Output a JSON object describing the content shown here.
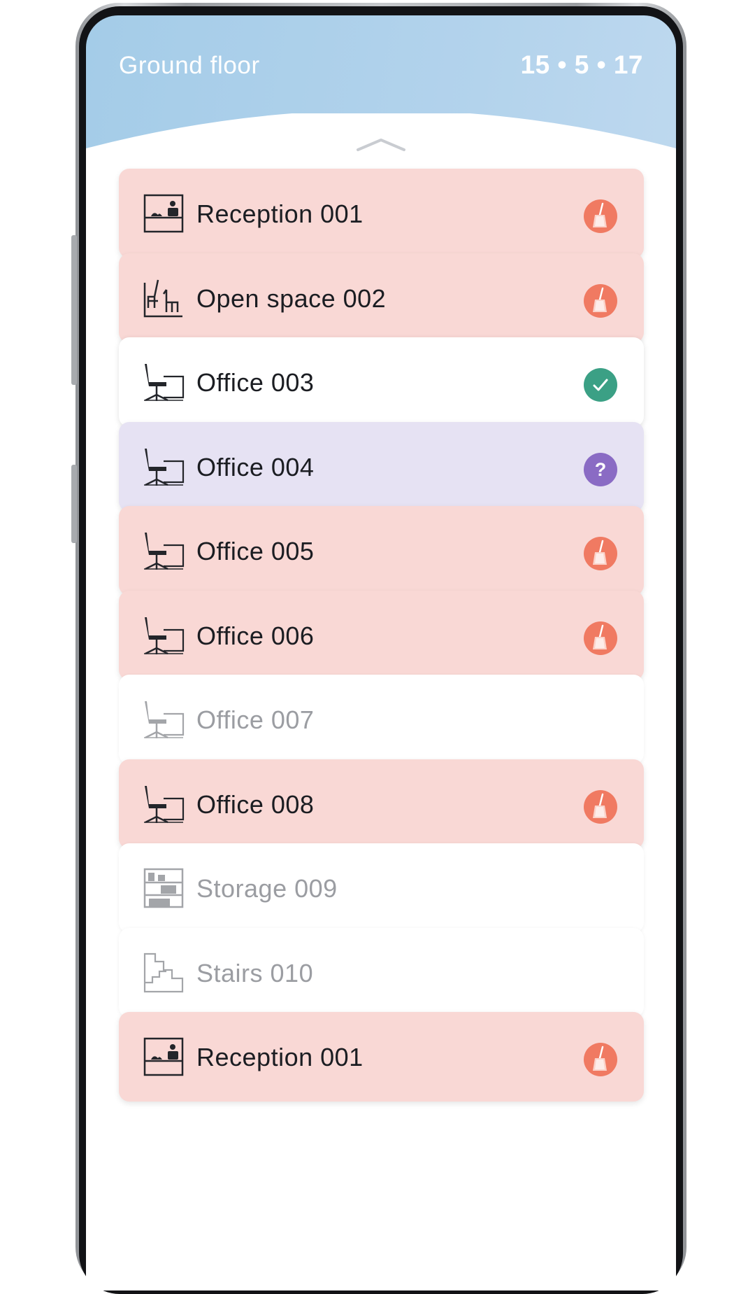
{
  "header": {
    "title": "Ground floor",
    "date": "15 • 5 • 17"
  },
  "colors": {
    "clean_needed": "#f07a62",
    "done": "#3ba085",
    "unknown": "#8a6bc4",
    "text_dark": "#1b1d22",
    "text_disabled": "#9b9da2"
  },
  "rooms": [
    {
      "label": "Reception 001",
      "icon": "reception-icon",
      "status": "needs-cleaning",
      "status_icon": "broom-icon"
    },
    {
      "label": "Open space 002",
      "icon": "open-space-icon",
      "status": "needs-cleaning",
      "status_icon": "broom-icon"
    },
    {
      "label": "Office 003",
      "icon": "office-chair-desk-icon",
      "status": "done",
      "status_icon": "check-icon"
    },
    {
      "label": "Office 004",
      "icon": "office-chair-desk-icon",
      "status": "unknown",
      "status_icon": "question-icon",
      "status_text": "?"
    },
    {
      "label": "Office 005",
      "icon": "office-chair-desk-icon",
      "status": "needs-cleaning",
      "status_icon": "broom-icon"
    },
    {
      "label": "Office 006",
      "icon": "office-chair-desk-icon",
      "status": "needs-cleaning",
      "status_icon": "broom-icon"
    },
    {
      "label": "Office 007",
      "icon": "office-chair-desk-icon",
      "status": "inactive"
    },
    {
      "label": "Office 008",
      "icon": "office-chair-desk-icon",
      "status": "needs-cleaning",
      "status_icon": "broom-icon"
    },
    {
      "label": "Storage 009",
      "icon": "storage-shelves-icon",
      "status": "inactive"
    },
    {
      "label": "Stairs 010",
      "icon": "stairs-icon",
      "status": "inactive"
    },
    {
      "label": "Reception 001",
      "icon": "reception-icon",
      "status": "needs-cleaning",
      "status_icon": "broom-icon"
    }
  ]
}
